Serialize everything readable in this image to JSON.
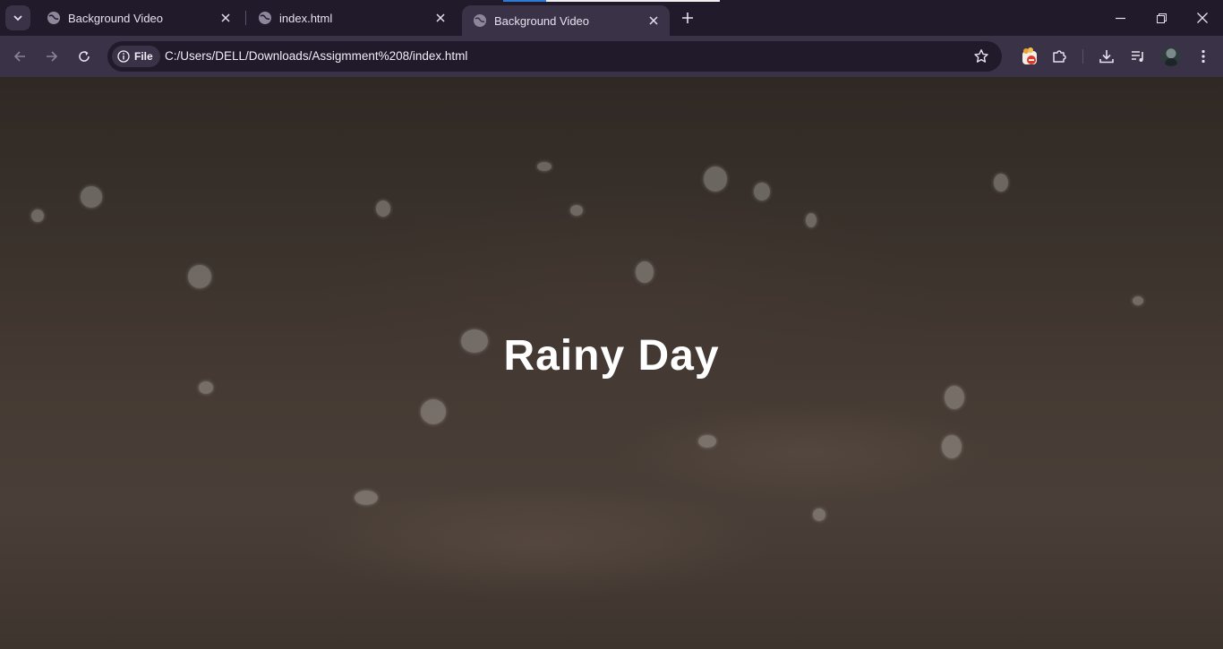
{
  "tabs": [
    {
      "label": "Background Video",
      "active": false
    },
    {
      "label": "index.html",
      "active": false
    },
    {
      "label": "Background Video",
      "active": true
    }
  ],
  "address_bar": {
    "scheme_chip": "File",
    "url": "C:/Users/DELL/Downloads/Assigmment%208/index.html"
  },
  "page": {
    "heading": "Rainy Day"
  },
  "colors": {
    "tab_strip": "#201a2b",
    "toolbar": "#3a3348",
    "heading_text": "#ffffff"
  },
  "icons": [
    "tab-search-icon",
    "globe-icon",
    "close-icon",
    "plus-icon",
    "minimize-icon",
    "restore-icon",
    "window-close-icon",
    "back-arrow-icon",
    "forward-arrow-icon",
    "reload-icon",
    "info-icon",
    "star-icon",
    "ad-block-extension-icon",
    "puzzle-icon",
    "download-icon",
    "media-control-icon",
    "profile-avatar",
    "kebab-menu-icon"
  ]
}
